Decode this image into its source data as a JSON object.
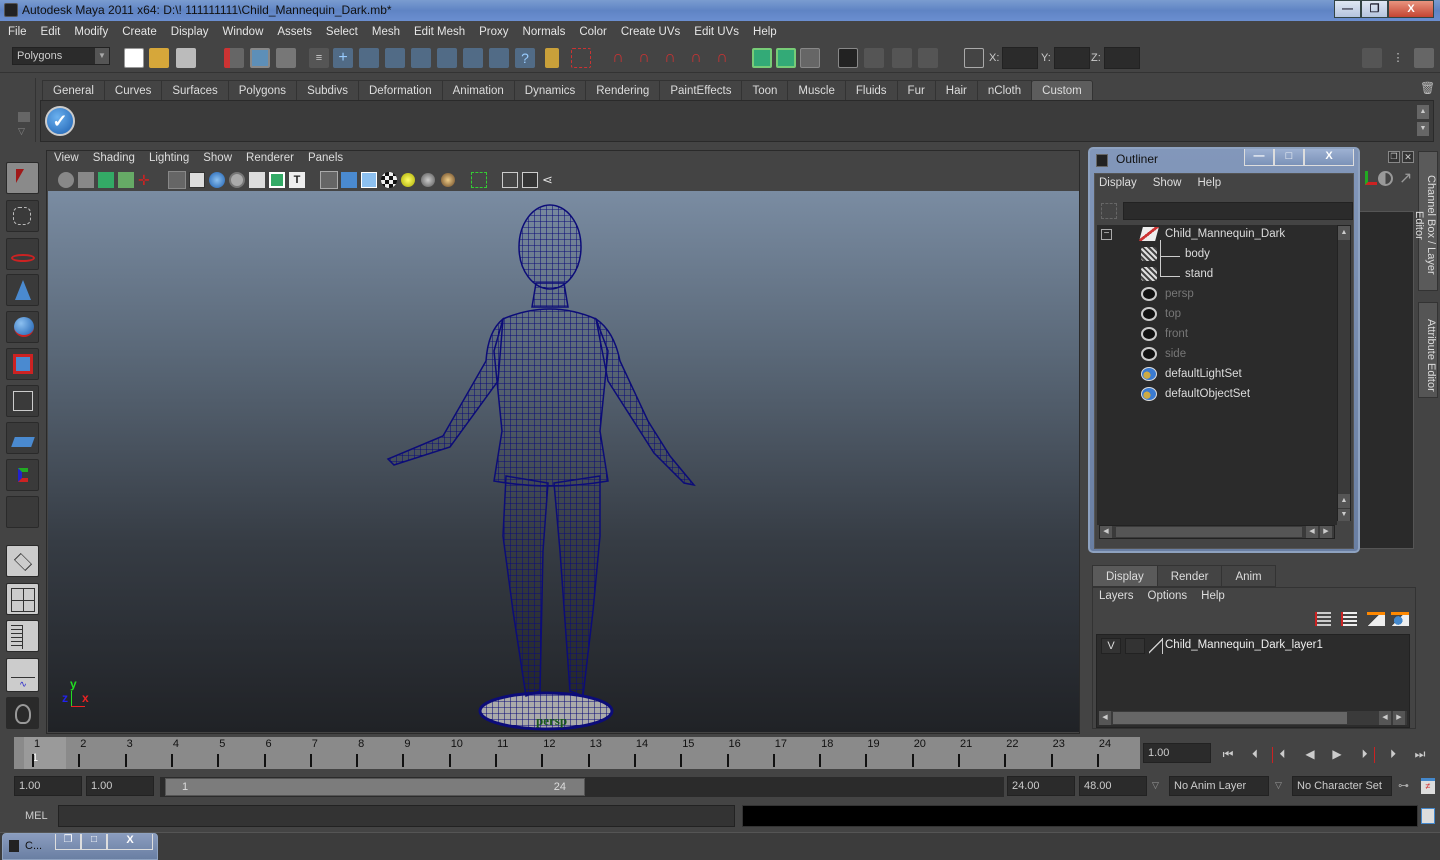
{
  "window": {
    "title": "Autodesk Maya 2011 x64: D:\\! 111111111\\Child_Mannequin_Dark.mb*",
    "minimize_label": "—",
    "restore_label": "❐",
    "close_label": "X"
  },
  "menubar": [
    "File",
    "Edit",
    "Modify",
    "Create",
    "Display",
    "Window",
    "Assets",
    "Select",
    "Mesh",
    "Edit Mesh",
    "Proxy",
    "Normals",
    "Color",
    "Create UVs",
    "Edit UVs",
    "Help"
  ],
  "statusline": {
    "mode_selector": "Polygons",
    "x_label": "X:",
    "y_label": "Y:",
    "z_label": "Z:",
    "x_value": "",
    "y_value": "",
    "z_value": ""
  },
  "shelf": {
    "tabs": [
      "General",
      "Curves",
      "Surfaces",
      "Polygons",
      "Subdivs",
      "Deformation",
      "Animation",
      "Dynamics",
      "Rendering",
      "PaintEffects",
      "Toon",
      "Muscle",
      "Fluids",
      "Fur",
      "Hair",
      "nCloth",
      "Custom"
    ],
    "active_tab": "Custom"
  },
  "viewport": {
    "menu": [
      "View",
      "Shading",
      "Lighting",
      "Show",
      "Renderer",
      "Panels"
    ],
    "camera_label": "persp",
    "axis": {
      "x": "x",
      "y": "y",
      "z": "z"
    },
    "wire_color": "#0c0c78"
  },
  "outliner": {
    "title": "Outliner",
    "menu": [
      "Display",
      "Show",
      "Help"
    ],
    "filter_value": "",
    "items": [
      {
        "label": "Child_Mannequin_Dark",
        "icon": "group-icon",
        "dim": false,
        "indent": 0
      },
      {
        "label": "body",
        "icon": "mesh-icon",
        "dim": false,
        "indent": 1
      },
      {
        "label": "stand",
        "icon": "mesh-icon",
        "dim": false,
        "indent": 1
      },
      {
        "label": "persp",
        "icon": "camera-icon",
        "dim": true,
        "indent": 0
      },
      {
        "label": "top",
        "icon": "camera-icon",
        "dim": true,
        "indent": 0
      },
      {
        "label": "front",
        "icon": "camera-icon",
        "dim": true,
        "indent": 0
      },
      {
        "label": "side",
        "icon": "camera-icon",
        "dim": true,
        "indent": 0
      },
      {
        "label": "defaultLightSet",
        "icon": "set-icon",
        "dim": false,
        "indent": 0
      },
      {
        "label": "defaultObjectSet",
        "icon": "set-icon",
        "dim": false,
        "indent": 0
      }
    ]
  },
  "side_tabs": {
    "channel_box": "Channel Box / Layer Editor",
    "attribute_editor": "Attribute Editor"
  },
  "layer_editor": {
    "tabs": [
      "Display",
      "Render",
      "Anim"
    ],
    "active_tab": "Display",
    "menu": [
      "Layers",
      "Options",
      "Help"
    ],
    "layers": [
      {
        "visible": "V",
        "name": "Child_Mannequin_Dark_layer1"
      }
    ]
  },
  "timeline": {
    "ticks": [
      "1",
      "2",
      "3",
      "4",
      "5",
      "6",
      "7",
      "8",
      "9",
      "10",
      "11",
      "12",
      "13",
      "14",
      "15",
      "16",
      "17",
      "18",
      "19",
      "20",
      "21",
      "22",
      "23",
      "24"
    ],
    "current_frame_marker": "1",
    "current_time": "1.00"
  },
  "range": {
    "start_time": "1.00",
    "playback_start": "1.00",
    "slider_start": "1",
    "slider_end": "24",
    "playback_end": "24.00",
    "end_time": "48.00",
    "anim_layer": "No Anim Layer",
    "character_set": "No Character Set"
  },
  "command_line": {
    "label": "MEL",
    "value": "",
    "result": ""
  },
  "minimized_window": {
    "label": "C..."
  }
}
